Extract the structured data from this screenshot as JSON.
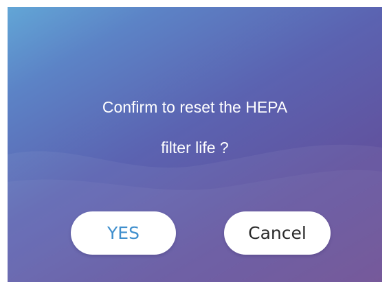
{
  "dialog": {
    "message_line1": "Confirm to reset the HEPA",
    "message_line2": "filter life ?",
    "confirm_label": "YES",
    "cancel_label": "Cancel"
  },
  "colors": {
    "gradient_start": "#62a6d6",
    "gradient_end": "#6a4a91",
    "confirm_text": "#3f8fcd",
    "cancel_text": "#2b2b2b",
    "button_background": "#ffffff"
  }
}
